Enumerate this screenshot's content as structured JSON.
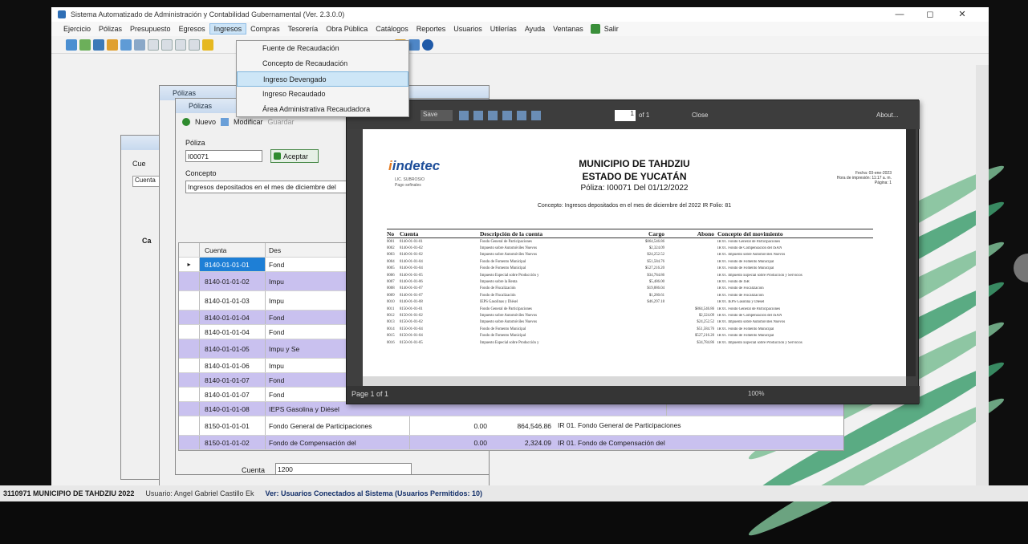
{
  "window": {
    "title": "Sistema Automatizado de Administración y Contabilidad Gubernamental (Ver. 2.3.0.0)",
    "controls": [
      "—",
      "◻",
      "✕"
    ]
  },
  "menu": {
    "items": [
      "Ejercicio",
      "Pólizas",
      "Presupuesto",
      "Egresos",
      "Ingresos",
      "Compras",
      "Tesorería",
      "Obra Pública",
      "Catálogos",
      "Reportes",
      "Usuarios",
      "Utilerías",
      "Ayuda",
      "Ventanas",
      "Salir"
    ],
    "active_index": 4
  },
  "ingresos_menu": {
    "items": [
      "Fuente de Recaudación",
      "Concepto de Recaudación",
      "Ingreso Devengado",
      "Ingreso Recaudado",
      "Área Administrativa Recaudadora"
    ],
    "selected_index": 2
  },
  "poliza_form": {
    "window_title": "Pólizas",
    "new_label": "Nuevo",
    "modify_label": "Modificar",
    "delete_label": "Guardar",
    "poliza_label": "Póliza",
    "poliza_value": "I00071",
    "accept_label": "Aceptar",
    "concepto_label": "Concepto",
    "concepto_value": "Ingresos depositados en el mes de diciembre del",
    "cuenta_label": "Cuenta",
    "cuenta_value": "1200",
    "side_label_1": "Cue",
    "side_label_2": "Cuenta",
    "side_label_3": "Ca"
  },
  "grid": {
    "headers": [
      "Cuenta",
      "Des"
    ],
    "rows": [
      {
        "cuenta": "8140-01-01-01",
        "desc": "Fond"
      },
      {
        "cuenta": "8140-01-01-02",
        "desc": "Impu"
      },
      {
        "cuenta": "8140-01-01-03",
        "desc": "Impu"
      },
      {
        "cuenta": "8140-01-01-04",
        "desc": "Fond"
      },
      {
        "cuenta": "8140-01-01-04",
        "desc": "Fond"
      },
      {
        "cuenta": "8140-01-01-05",
        "desc": "Impu y Se"
      },
      {
        "cuenta": "8140-01-01-06",
        "desc": "Impu"
      },
      {
        "cuenta": "8140-01-01-07",
        "desc": "Fond"
      },
      {
        "cuenta": "8140-01-01-07",
        "desc": "Fond"
      },
      {
        "cuenta": "8140-01-01-08",
        "desc": "IEPS Gasolina y Diésel"
      },
      {
        "cuenta": "8150-01-01-01",
        "desc": "Fondo General de Participaciones"
      },
      {
        "cuenta": "8150-01-01-02",
        "desc": "Fondo de Compensación del"
      }
    ],
    "bottom_rows": [
      {
        "cargo": "0.00",
        "abono": "864,546.86",
        "concepto": "IR 01. Fondo General de Participaciones"
      },
      {
        "cargo": "0.00",
        "abono": "2,324.09",
        "concepto": "IR 01. Fondo de Compensación del"
      }
    ]
  },
  "report": {
    "toolbar": {
      "save_label": "Save",
      "page_value": "1",
      "page_of": "of 1",
      "close_label": "Close",
      "about_label": "About..."
    },
    "logo_text": "indetec",
    "logo_sub": [
      "LIC. SUBROSIO",
      "Pago sefinales"
    ],
    "municipio": "MUNICIPIO DE TAHDZIU",
    "estado": "ESTADO DE YUCATÁN",
    "poliza_line": "Póliza: I00071  Del 01/12/2022",
    "fecha_label": "Fecha",
    "fecha_value": "03-ene-2023",
    "hora_label": "Hora de impresión",
    "hora_value": "11:17 a. m.",
    "pagina_label": "Página",
    "pagina_value": "1",
    "concepto_line": "Concepto: Ingresos depositados en el mes de diciembre del 2022 IR Folio: 81",
    "columns": [
      "No",
      "Cuenta",
      "Descripción de la cuenta",
      "Cargo",
      "Abono",
      "Concepto del movimiento"
    ],
    "rows": [
      {
        "no": "0001",
        "cuenta": "8140-01-01-01",
        "desc": "Fondo General de Participaciones",
        "cargo": "$864,546.86",
        "abono": "",
        "concepto": "IR 01. Fondo General de Participaciones"
      },
      {
        "no": "0002",
        "cuenta": "8140-01-01-02",
        "desc": "Impuesto sobre Automóviles Nuevos",
        "cargo": "$2,324.09",
        "abono": "",
        "concepto": "IR 01. Fondo de Compensación del ISAN"
      },
      {
        "no": "0003",
        "cuenta": "8140-01-01-02",
        "desc": "Impuesto sobre Automóviles Nuevos",
        "cargo": "$24,252.52",
        "abono": "",
        "concepto": "IR 01. Impuesto sobre Automóviles Nuevos"
      },
      {
        "no": "0004",
        "cuenta": "8140-01-01-04",
        "desc": "Fondo de Fomento Municipal",
        "cargo": "$51,584.76",
        "abono": "",
        "concepto": "IR 01. Fondo de Fomento Municipal"
      },
      {
        "no": "0005",
        "cuenta": "8140-01-01-04",
        "desc": "Fondo de Fomento Municipal",
        "cargo": "$527,216.20",
        "abono": "",
        "concepto": "IR 01. Fondo de Fomento Municipal"
      },
      {
        "no": "0006",
        "cuenta": "8140-01-01-05",
        "desc": "Impuesto Especial sobre Producción y",
        "cargo": "$34,784.86",
        "abono": "",
        "concepto": "IR 01. Impuesto Especial sobre Producción y Servicios"
      },
      {
        "no": "0007",
        "cuenta": "8140-01-01-06",
        "desc": "Impuesto sobre la Renta",
        "cargo": "$5,486.00",
        "abono": "",
        "concepto": "IR 01. Fondo de ISR"
      },
      {
        "no": "0008",
        "cuenta": "8140-01-01-07",
        "desc": "Fondo de Fiscalización",
        "cargo": "$19,886.04",
        "abono": "",
        "concepto": "IR 01. Fondo de Fiscalización"
      },
      {
        "no": "0009",
        "cuenta": "8140-01-01-07",
        "desc": "Fondo de Fiscalización",
        "cargo": "$1,280.61",
        "abono": "",
        "concepto": "IR 01. Fondo de Fiscalización"
      },
      {
        "no": "0010",
        "cuenta": "8140-01-01-08",
        "desc": "IEPS Gasolinas y Diésel",
        "cargo": "$46,297.18",
        "abono": "",
        "concepto": "IR 01. IEPS Gasolina y Diésel"
      },
      {
        "no": "0011",
        "cuenta": "8150-01-01-01",
        "desc": "Fondo General de Participaciones",
        "cargo": "",
        "abono": "$864,546.86",
        "concepto": "IR 01. Fondo General de Participaciones"
      },
      {
        "no": "0012",
        "cuenta": "8150-01-01-02",
        "desc": "Impuesto sobre Automóviles Nuevos",
        "cargo": "",
        "abono": "$2,324.09",
        "concepto": "IR 01. Fondo de Compensación del ISAN"
      },
      {
        "no": "0013",
        "cuenta": "8150-01-01-02",
        "desc": "Impuesto sobre Automóviles Nuevos",
        "cargo": "",
        "abono": "$24,252.52",
        "concepto": "IR 01. Impuesto sobre Automóviles Nuevos"
      },
      {
        "no": "0014",
        "cuenta": "8150-01-01-04",
        "desc": "Fondo de Fomento Municipal",
        "cargo": "",
        "abono": "$51,584.76",
        "concepto": "IR 01. Fondo de Fomento Municipal"
      },
      {
        "no": "0015",
        "cuenta": "8150-01-01-04",
        "desc": "Fondo de Fomento Municipal",
        "cargo": "",
        "abono": "$527,216.20",
        "concepto": "IR 01. Fondo de Fomento Municipal"
      },
      {
        "no": "0016",
        "cuenta": "8150-01-01-05",
        "desc": "Impuesto Especial sobre Producción y",
        "cargo": "",
        "abono": "$34,784.86",
        "concepto": "IR 01. Impuesto Especial sobre Producción y Servicios"
      }
    ],
    "footer_page": "Page 1 of 1",
    "zoom_label": "100%"
  },
  "statusbar": {
    "entity": "3110971 MUNICIPIO DE TAHDZIU  2022",
    "user": "Usuario: Angel Gabriel Castillo Ek",
    "connected": "Ver: Usuarios Conectados al Sistema  (Usuarios Permitidos: 10)"
  }
}
